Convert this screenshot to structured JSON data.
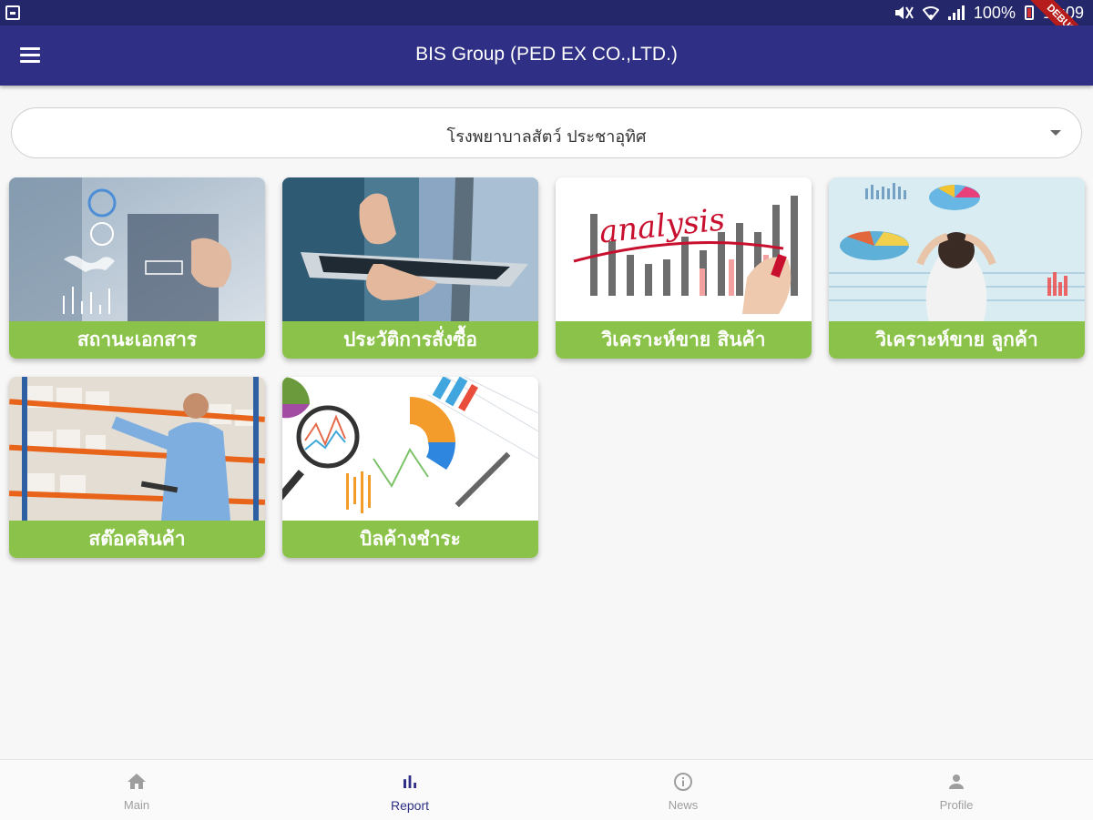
{
  "status_bar": {
    "battery": "100%",
    "time": "14:09"
  },
  "debug_banner": "DEBUG",
  "app_bar": {
    "title": "BIS Group (PED EX CO.,LTD.)"
  },
  "branch_select": {
    "selected": "โรงพยาบาลสัตว์ ประชาอุทิศ"
  },
  "colors": {
    "app_bar": "#2e2f85",
    "status_bar": "#24276a",
    "card_label": "#8bc34a",
    "nav_active": "#2e2f85",
    "nav_inactive": "#9e9e9e"
  },
  "menu_cards": [
    {
      "label": "สถานะเอกสาร",
      "image": "business-world-map-image"
    },
    {
      "label": "ประวัติการสั่งซื้อ",
      "image": "tablet-touch-image"
    },
    {
      "label": "วิเคราะห์ขาย สินค้า",
      "image": "analysis-chart-image",
      "image_text": "analysis"
    },
    {
      "label": "วิเคราะห์ขาย ลูกค้า",
      "image": "woman-charts-image"
    },
    {
      "label": "สต๊อคสินค้า",
      "image": "warehouse-man-image"
    },
    {
      "label": "บิลค้างชำระ",
      "image": "magnifier-charts-image"
    }
  ],
  "bottom_nav": [
    {
      "label": "Main",
      "icon": "home-icon",
      "active": false
    },
    {
      "label": "Report",
      "icon": "bar-chart-icon",
      "active": true
    },
    {
      "label": "News",
      "icon": "info-icon",
      "active": false
    },
    {
      "label": "Profile",
      "icon": "person-icon",
      "active": false
    }
  ]
}
